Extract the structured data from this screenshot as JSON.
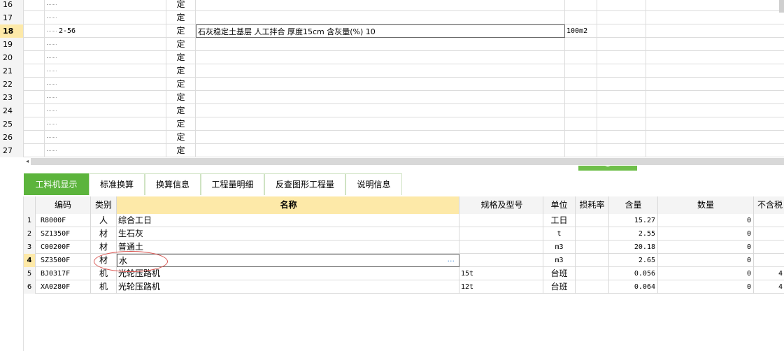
{
  "top_grid": {
    "rows": [
      {
        "num": "16",
        "code": "",
        "type": "定",
        "name": "",
        "unit": ""
      },
      {
        "num": "17",
        "code": "",
        "type": "定",
        "name": "",
        "unit": ""
      },
      {
        "num": "18",
        "code": "2-56",
        "type": "定",
        "name": "石灰稳定土基层 人工拌合 厚度15cm 含灰量(%) 10",
        "unit": "100m2",
        "selected": true
      },
      {
        "num": "19",
        "code": "",
        "type": "定",
        "name": "",
        "unit": ""
      },
      {
        "num": "20",
        "code": "",
        "type": "定",
        "name": "",
        "unit": ""
      },
      {
        "num": "21",
        "code": "",
        "type": "定",
        "name": "",
        "unit": ""
      },
      {
        "num": "22",
        "code": "",
        "type": "定",
        "name": "",
        "unit": ""
      },
      {
        "num": "23",
        "code": "",
        "type": "定",
        "name": "",
        "unit": ""
      },
      {
        "num": "24",
        "code": "",
        "type": "定",
        "name": "",
        "unit": ""
      },
      {
        "num": "25",
        "code": "",
        "type": "定",
        "name": "",
        "unit": ""
      },
      {
        "num": "26",
        "code": "",
        "type": "定",
        "name": "",
        "unit": ""
      },
      {
        "num": "27",
        "code": "",
        "type": "定",
        "name": "",
        "unit": ""
      }
    ],
    "hscroll_arrow": "◂",
    "splitter_glyph": "︾"
  },
  "tabs": [
    {
      "label": "工料机显示",
      "active": true
    },
    {
      "label": "标准换算"
    },
    {
      "label": "换算信息"
    },
    {
      "label": "工程量明细"
    },
    {
      "label": "反查图形工程量"
    },
    {
      "label": "说明信息"
    }
  ],
  "bottom_grid": {
    "headers": {
      "code": "编码",
      "type": "类别",
      "name": "名称",
      "spec": "规格及型号",
      "unit": "单位",
      "loss": "损耗率",
      "qty": "含量",
      "amount": "数量",
      "price": "不含税"
    },
    "rows": [
      {
        "num": "1",
        "code": "R8000F",
        "type": "人",
        "name": "综合工日",
        "spec": "",
        "unit": "工日",
        "qty": "15.27",
        "amount": "0",
        "ext": ""
      },
      {
        "num": "2",
        "code": "SZ1350F",
        "type": "材",
        "name": "生石灰",
        "spec": "",
        "unit": "t",
        "qty": "2.55",
        "amount": "0",
        "ext": ""
      },
      {
        "num": "3",
        "code": "C00200F",
        "type": "材",
        "name": "普通土",
        "spec": "",
        "unit": "m3",
        "qty": "20.18",
        "amount": "0",
        "ext": ""
      },
      {
        "num": "4",
        "code": "SZ3500F",
        "type": "材",
        "name": "水",
        "spec": "",
        "unit": "m3",
        "qty": "2.65",
        "amount": "0",
        "ext": "",
        "selected": true,
        "ellipsis": "···"
      },
      {
        "num": "5",
        "code": "BJ0317F",
        "type": "机",
        "name": "光轮压路机",
        "spec": "15t",
        "unit": "台班",
        "qty": "0.056",
        "amount": "0",
        "ext": "4"
      },
      {
        "num": "6",
        "code": "XA0280F",
        "type": "机",
        "name": "光轮压路机",
        "spec": "12t",
        "unit": "台班",
        "qty": "0.064",
        "amount": "0",
        "ext": "4"
      }
    ]
  },
  "colors": {
    "accent_green": "#5cb43c",
    "selected_row": "#fde9a8",
    "annotation_red": "#d9534f"
  }
}
